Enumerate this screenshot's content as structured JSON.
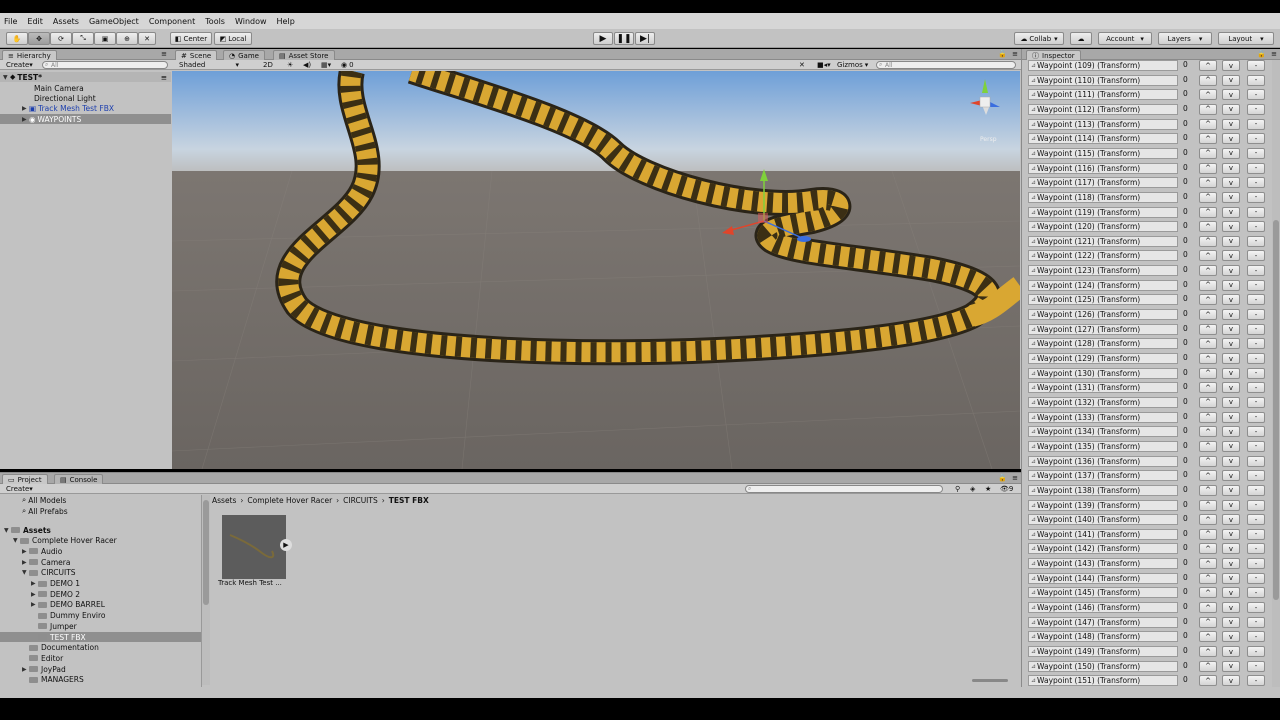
{
  "menu": [
    "File",
    "Edit",
    "Assets",
    "GameObject",
    "Component",
    "Tools",
    "Window",
    "Help"
  ],
  "toolbar": {
    "pivot": "Center",
    "space": "Local",
    "collab": "Collab",
    "account": "Account",
    "layers": "Layers",
    "layout": "Layout"
  },
  "hierarchy": {
    "tab": "Hierarchy",
    "create": "Create",
    "search_placeholder": "All",
    "scene": "TEST*",
    "items": [
      {
        "label": "Main Camera"
      },
      {
        "label": "Directional Light"
      },
      {
        "label": "Track Mesh Test FBX"
      },
      {
        "label": "WAYPOINTS"
      }
    ]
  },
  "scene_view": {
    "tabs": [
      "Scene",
      "Game",
      "Asset Store"
    ],
    "shading": "Shaded",
    "mode_2d": "2D",
    "effects_count": "0",
    "gizmos": "Gizmos",
    "search_placeholder": "All",
    "persp": "Persp"
  },
  "project": {
    "tabs": [
      "Project",
      "Console"
    ],
    "create": "Create",
    "favorites": [
      "All Models",
      "All Prefabs"
    ],
    "tree": [
      {
        "label": "Assets",
        "depth": 0,
        "bold": true,
        "open": true
      },
      {
        "label": "Complete Hover Racer",
        "depth": 1,
        "open": true
      },
      {
        "label": "Audio",
        "depth": 2,
        "arrow": true
      },
      {
        "label": "Camera",
        "depth": 2,
        "arrow": true
      },
      {
        "label": "CIRCUITS",
        "depth": 2,
        "open": true
      },
      {
        "label": "DEMO 1",
        "depth": 3,
        "arrow": true
      },
      {
        "label": "DEMO 2",
        "depth": 3,
        "arrow": true
      },
      {
        "label": "DEMO BARREL",
        "depth": 3,
        "arrow": true
      },
      {
        "label": "Dummy Enviro",
        "depth": 3
      },
      {
        "label": "Jumper",
        "depth": 3
      },
      {
        "label": "TEST FBX",
        "depth": 3,
        "selected": true
      },
      {
        "label": "Documentation",
        "depth": 2
      },
      {
        "label": "Editor",
        "depth": 2
      },
      {
        "label": "JoyPad",
        "depth": 2,
        "arrow": true
      },
      {
        "label": "MANAGERS",
        "depth": 2
      }
    ],
    "breadcrumb": [
      "Assets",
      "Complete Hover Racer",
      "CIRCUITS",
      "TEST FBX"
    ],
    "asset_label": "Track Mesh Test ..."
  },
  "inspector": {
    "tab": "Inspector",
    "zero": "0",
    "up": "^",
    "down": "v",
    "minus": "-",
    "waypoints": [
      "Waypoint (109) (Transform)",
      "Waypoint (110) (Transform)",
      "Waypoint (111) (Transform)",
      "Waypoint (112) (Transform)",
      "Waypoint (113) (Transform)",
      "Waypoint (114) (Transform)",
      "Waypoint (115) (Transform)",
      "Waypoint (116) (Transform)",
      "Waypoint (117) (Transform)",
      "Waypoint (118) (Transform)",
      "Waypoint (119) (Transform)",
      "Waypoint (120) (Transform)",
      "Waypoint (121) (Transform)",
      "Waypoint (122) (Transform)",
      "Waypoint (123) (Transform)",
      "Waypoint (124) (Transform)",
      "Waypoint (125) (Transform)",
      "Waypoint (126) (Transform)",
      "Waypoint (127) (Transform)",
      "Waypoint (128) (Transform)",
      "Waypoint (129) (Transform)",
      "Waypoint (130) (Transform)",
      "Waypoint (131) (Transform)",
      "Waypoint (132) (Transform)",
      "Waypoint (133) (Transform)",
      "Waypoint (134) (Transform)",
      "Waypoint (135) (Transform)",
      "Waypoint (136) (Transform)",
      "Waypoint (137) (Transform)",
      "Waypoint (138) (Transform)",
      "Waypoint (139) (Transform)",
      "Waypoint (140) (Transform)",
      "Waypoint (141) (Transform)",
      "Waypoint (142) (Transform)",
      "Waypoint (143) (Transform)",
      "Waypoint (144) (Transform)",
      "Waypoint (145) (Transform)",
      "Waypoint (146) (Transform)",
      "Waypoint (147) (Transform)",
      "Waypoint (148) (Transform)",
      "Waypoint (149) (Transform)",
      "Waypoint (150) (Transform)",
      "Waypoint (151) (Transform)"
    ]
  }
}
